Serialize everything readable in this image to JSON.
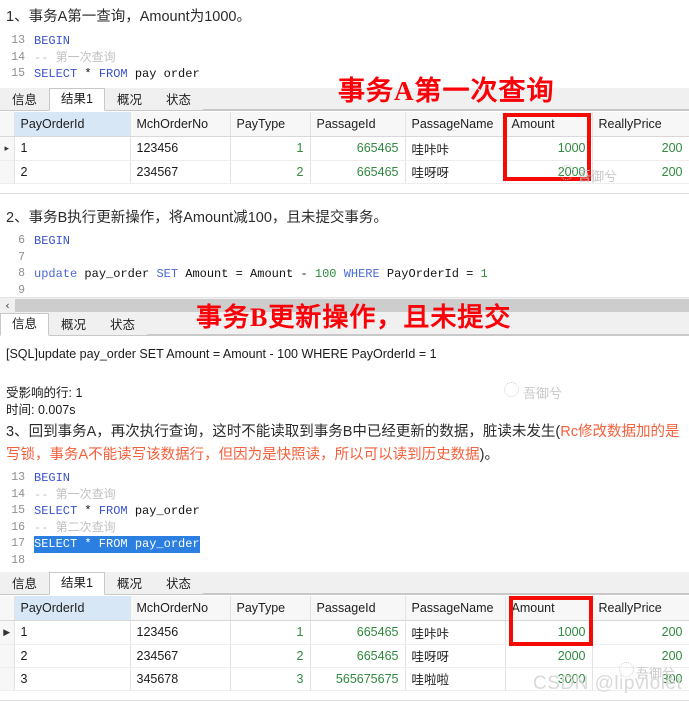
{
  "sections": [
    {
      "heading": "1、事务A第一查询，Amount为1000。",
      "code": {
        "lines": [
          {
            "no": "13",
            "tokens": [
              {
                "t": "BEGIN",
                "c": "kw"
              }
            ]
          },
          {
            "no": "14",
            "tokens": [
              {
                "t": "-- 第一次查询",
                "c": "cmt"
              }
            ]
          },
          {
            "no": "15",
            "tokens": [
              {
                "t": "SELECT",
                "c": "kw"
              },
              {
                "t": " * ",
                "c": "op"
              },
              {
                "t": "FROM",
                "c": "kw"
              },
              {
                "t": " pay order",
                "c": "ctext"
              }
            ]
          }
        ]
      },
      "tabs": [
        {
          "label": "信息",
          "active": false
        },
        {
          "label": "结果1",
          "active": true
        },
        {
          "label": "概况",
          "active": false
        },
        {
          "label": "状态",
          "active": false
        }
      ],
      "grid": {
        "columns": [
          "PayOrderId",
          "MchOrderNo",
          "PayType",
          "PassageId",
          "PassageName",
          "Amount",
          "ReallyPrice"
        ],
        "highlight_column": "PayOrderId",
        "rows": [
          {
            "marked": true,
            "cells": [
              "1",
              "123456",
              "1",
              "665465",
              "哇咔咔",
              "1000",
              "200"
            ]
          },
          {
            "marked": false,
            "cells": [
              "2",
              "234567",
              "2",
              "665465",
              "哇呀呀",
              "2000",
              "200"
            ]
          }
        ]
      },
      "annotation": "事务A第一次查询"
    },
    {
      "heading": "2、事务B执行更新操作，将Amount减100，且未提交事务。",
      "code": {
        "lines": [
          {
            "no": "6",
            "tokens": [
              {
                "t": "BEGIN",
                "c": "kw"
              }
            ]
          },
          {
            "no": "7",
            "tokens": [
              {
                "t": "",
                "c": "ctext"
              }
            ]
          },
          {
            "no": "8",
            "tokens": [
              {
                "t": "update",
                "c": "kw2"
              },
              {
                "t": " pay_order ",
                "c": "ctext"
              },
              {
                "t": "SET",
                "c": "kw2"
              },
              {
                "t": " Amount = Amount - ",
                "c": "ctext"
              },
              {
                "t": "100",
                "c": "num"
              },
              {
                "t": " ",
                "c": "ctext"
              },
              {
                "t": "WHERE",
                "c": "kw2"
              },
              {
                "t": " PayOrderId = ",
                "c": "ctext"
              },
              {
                "t": "1",
                "c": "num"
              }
            ]
          },
          {
            "no": "9",
            "tokens": [
              {
                "t": "",
                "c": "ctext"
              }
            ]
          }
        ]
      },
      "scrollbar_arrow": "‹",
      "tabs": [
        {
          "label": "信息",
          "active": true
        },
        {
          "label": "概况",
          "active": false
        },
        {
          "label": "状态",
          "active": false
        }
      ],
      "message": {
        "sql": "[SQL]update pay_order SET Amount = Amount - 100 WHERE PayOrderId = 1",
        "affected_rows": "受影响的行: 1",
        "time": "时间: 0.007s"
      },
      "annotation": "事务B更新操作，且未提交"
    },
    {
      "heading_part1": "3、回到事务A，再次执行查询，这时不能读取到事务B中已经更新的数据，脏读未发生(",
      "heading_part2": "Rc修改数据加的是写锁，事务A不能读写该数据行，但因为是快照读，所以可以读到历史数据",
      "heading_part3": ")。",
      "code": {
        "lines": [
          {
            "no": "13",
            "tokens": [
              {
                "t": "BEGIN",
                "c": "kw"
              }
            ]
          },
          {
            "no": "14",
            "tokens": [
              {
                "t": "-- 第一次查询",
                "c": "cmt"
              }
            ]
          },
          {
            "no": "15",
            "tokens": [
              {
                "t": "SELECT",
                "c": "kw"
              },
              {
                "t": " * ",
                "c": "op"
              },
              {
                "t": "FROM",
                "c": "kw"
              },
              {
                "t": " pay_order",
                "c": "ctext"
              }
            ]
          },
          {
            "no": "16",
            "tokens": [
              {
                "t": "-- 第二次查询",
                "c": "cmt"
              }
            ]
          },
          {
            "no": "17",
            "selected": true,
            "tokens": [
              {
                "t": "SELECT * FROM pay_order",
                "c": "ctext"
              }
            ]
          },
          {
            "no": "18",
            "tokens": [
              {
                "t": "",
                "c": "ctext"
              }
            ]
          }
        ]
      },
      "tabs": [
        {
          "label": "信息",
          "active": false
        },
        {
          "label": "结果1",
          "active": true
        },
        {
          "label": "概况",
          "active": false
        },
        {
          "label": "状态",
          "active": false
        }
      ],
      "grid": {
        "columns": [
          "PayOrderId",
          "MchOrderNo",
          "PayType",
          "PassageId",
          "PassageName",
          "Amount",
          "ReallyPrice"
        ],
        "highlight_column": "PayOrderId",
        "rows": [
          {
            "marked": true,
            "cells": [
              "1",
              "123456",
              "1",
              "665465",
              "哇咔咔",
              "1000",
              "200"
            ]
          },
          {
            "marked": false,
            "cells": [
              "2",
              "234567",
              "2",
              "665465",
              "哇呀呀",
              "2000",
              "200"
            ]
          },
          {
            "marked": false,
            "cells": [
              "3",
              "345678",
              "3",
              "565675675",
              "哇啦啦",
              "3000",
              "300"
            ]
          }
        ]
      }
    }
  ],
  "watermarks": {
    "zh_1": "吾御兮",
    "zh_2": "吾御兮",
    "zh_3": "吾御兮",
    "csdn": "CSDN @lipviolet"
  },
  "colors": {
    "annotation_red": "#fb0007",
    "box_red": "#f30b06",
    "orange_text": "#f4603c",
    "keyword_blue": "#3a53cc",
    "number_green": "#2f8a3f",
    "selection_blue": "#2a7fe0",
    "header_highlight": "#d7e7f5"
  }
}
